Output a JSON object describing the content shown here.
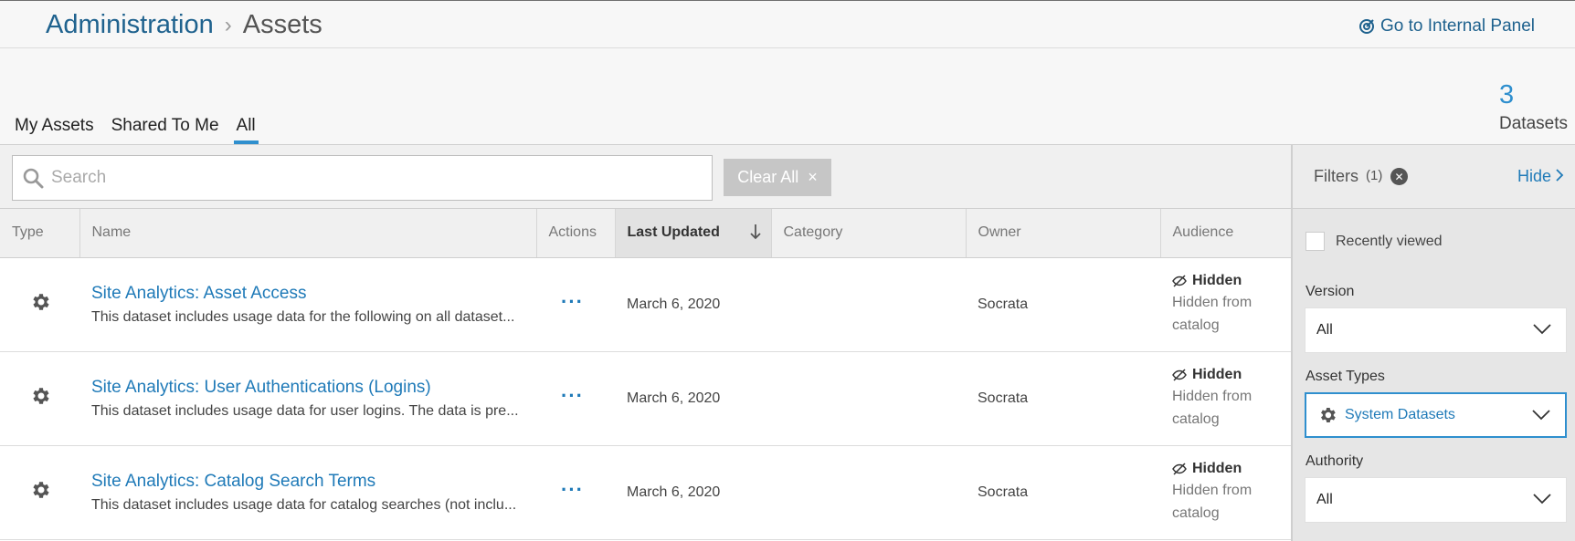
{
  "breadcrumb": {
    "parent": "Administration",
    "separator": "›",
    "current": "Assets"
  },
  "header": {
    "internal_link": "Go to Internal Panel"
  },
  "tabs": [
    {
      "label": "My Assets",
      "active": false
    },
    {
      "label": "Shared To Me",
      "active": false
    },
    {
      "label": "All",
      "active": true
    }
  ],
  "summary": {
    "count": "3",
    "label": "Datasets"
  },
  "search": {
    "placeholder": "Search",
    "value": "",
    "clear_label": "Clear All",
    "clear_icon": "×"
  },
  "table": {
    "columns": [
      "Type",
      "Name",
      "Actions",
      "Last Updated",
      "Category",
      "Owner",
      "Audience"
    ],
    "sorted_column": "Last Updated",
    "rows": [
      {
        "type_icon": "gear-icon",
        "name": "Site Analytics: Asset Access",
        "description": "This dataset includes usage data for the following on all dataset...",
        "actions": "···",
        "last_updated": "March 6, 2020",
        "category": "",
        "owner": "Socrata",
        "audience_title": "Hidden",
        "audience_sub": "Hidden from catalog"
      },
      {
        "type_icon": "gear-icon",
        "name": "Site Analytics: User Authentications (Logins)",
        "description": "This dataset includes usage data for user logins. The data is pre...",
        "actions": "···",
        "last_updated": "March 6, 2020",
        "category": "",
        "owner": "Socrata",
        "audience_title": "Hidden",
        "audience_sub": "Hidden from catalog"
      },
      {
        "type_icon": "gear-icon",
        "name": "Site Analytics: Catalog Search Terms",
        "description": "This dataset includes usage data for catalog searches (not inclu...",
        "actions": "···",
        "last_updated": "March 6, 2020",
        "category": "",
        "owner": "Socrata",
        "audience_title": "Hidden",
        "audience_sub": "Hidden from catalog"
      }
    ]
  },
  "filters": {
    "title": "Filters",
    "count": "(1)",
    "hide_label": "Hide",
    "recently_viewed": "Recently viewed",
    "version_label": "Version",
    "version_value": "All",
    "asset_types_label": "Asset Types",
    "asset_types_value": "System Datasets",
    "authority_label": "Authority",
    "authority_value": "All"
  },
  "colors": {
    "link": "#1f7ab8",
    "accent": "#2f8fce",
    "breadcrumb": "#1f628e"
  }
}
